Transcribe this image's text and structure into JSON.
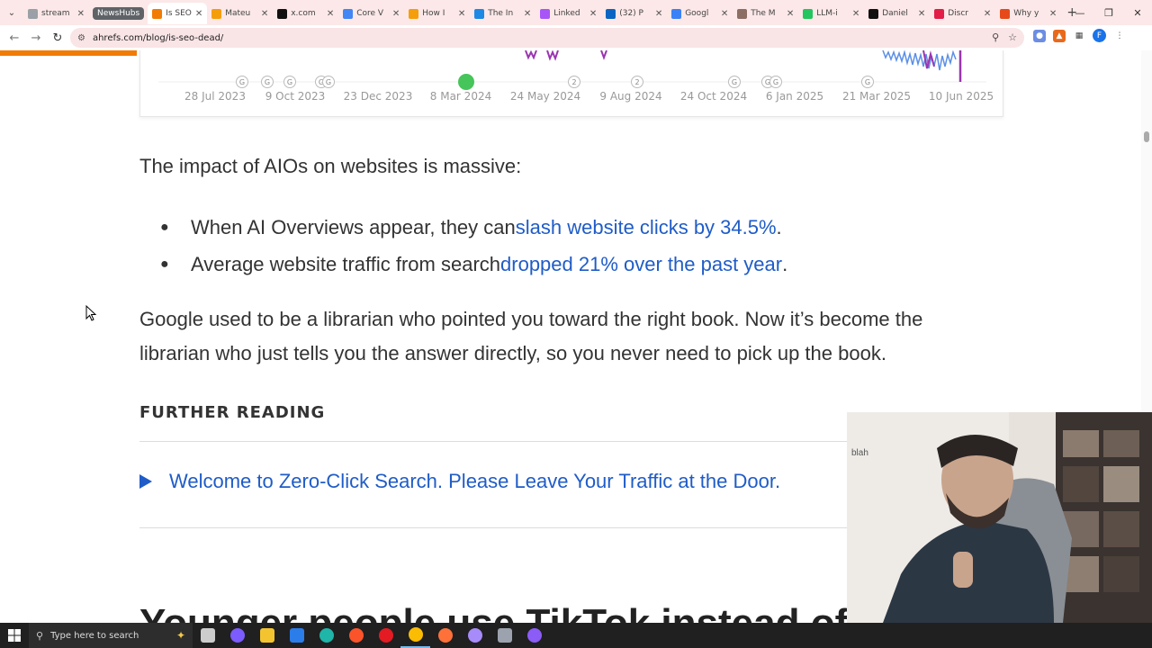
{
  "browser": {
    "tabs": [
      {
        "label": "stream",
        "color": "#9aa0a6"
      },
      {
        "label": "Is SEO",
        "color": "#f27b06",
        "active": true
      },
      {
        "label": "Mateu",
        "color": "#f59e0b"
      },
      {
        "label": "x.com",
        "color": "#111111"
      },
      {
        "label": "Core V",
        "color": "#4285f4"
      },
      {
        "label": "How I",
        "color": "#f59e0b"
      },
      {
        "label": "The In",
        "color": "#1e88e5"
      },
      {
        "label": "Linked",
        "color": "#a855f7"
      },
      {
        "label": "(32) P",
        "color": "#0a66c2"
      },
      {
        "label": "Googl",
        "color": "#3b82f6"
      },
      {
        "label": "The M",
        "color": "#8d6e63"
      },
      {
        "label": "LLM-i",
        "color": "#22c55e"
      },
      {
        "label": "Daniel",
        "color": "#111111"
      },
      {
        "label": "Discr",
        "color": "#e11d48"
      },
      {
        "label": "Why y",
        "color": "#e64a19"
      }
    ],
    "tab_group": "NewsHubs",
    "new_tab_label": "+",
    "url": "ahrefs.com/blog/is-seo-dead/",
    "profile_initial": "F"
  },
  "chart": {
    "dates": [
      "28 Jul 2023",
      "9 Oct 2023",
      "23 Dec 2023",
      "8 Mar 2024",
      "24 May 2024",
      "9 Aug 2024",
      "24 Oct 2024",
      "6 Jan 2025",
      "21 Mar 2025",
      "10 Jun 2025"
    ],
    "pins": [
      "G",
      "G",
      "G",
      "G",
      "G",
      "2",
      "2",
      "G",
      "G",
      "G",
      "G"
    ]
  },
  "article": {
    "intro": "The impact of AIOs on websites is massive:",
    "bullets": [
      {
        "text": "When AI Overviews appear, they can ",
        "link": "slash website clicks by 34.5%",
        "tail": "."
      },
      {
        "text": "Average website traffic from search ",
        "link": "dropped 21% over the past year",
        "tail": "."
      }
    ],
    "librarian_line1": "Google used to be a librarian who pointed you toward the right book. Now it’s become the",
    "librarian_line2": "librarian who just tells you the answer directly, so you never need to pick up the book.",
    "further_reading": "FURTHER READING",
    "further_link": "Welcome to Zero-Click Search. Please Leave Your Traffic at the Door.",
    "next_heading": "Younger people use TikTok instead of"
  },
  "taskbar": {
    "search_placeholder": "Type here to search",
    "apps": [
      {
        "name": "task-view",
        "color": "#cccccc"
      },
      {
        "name": "copilot",
        "color": "#7c5cff"
      },
      {
        "name": "file-explorer",
        "color": "#f4c430"
      },
      {
        "name": "app-blue",
        "color": "#2b7de9"
      },
      {
        "name": "edge",
        "color": "#1fb5a8"
      },
      {
        "name": "brave",
        "color": "#fb542b"
      },
      {
        "name": "opera",
        "color": "#e41b23"
      },
      {
        "name": "chrome",
        "color": "#fbbc04"
      },
      {
        "name": "firefox",
        "color": "#ff7139"
      },
      {
        "name": "app-round",
        "color": "#a78bfa"
      },
      {
        "name": "app-gear",
        "color": "#9ca3af"
      },
      {
        "name": "app-purple",
        "color": "#8b5cf6"
      }
    ]
  }
}
